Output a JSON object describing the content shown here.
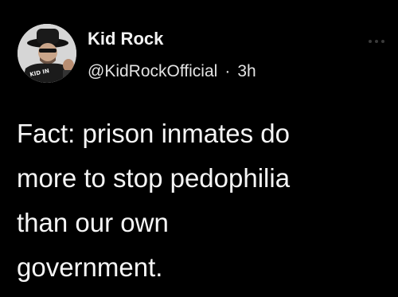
{
  "tweet": {
    "author_name": "Kid Rock",
    "handle": "@KidRockOfficial",
    "separator": "·",
    "time": "3h",
    "more_icon": "more-horizontal-icon",
    "avatar_shirt_text": "KID IN",
    "lines": [
      "Fact: prison inmates do",
      "more to stop pedophilia",
      "than our own",
      "government."
    ]
  },
  "colors": {
    "background": "#000000",
    "text": "#f5f5f5",
    "secondary_text": "#e3e3e3",
    "more_icon": "#3a3a3a"
  }
}
